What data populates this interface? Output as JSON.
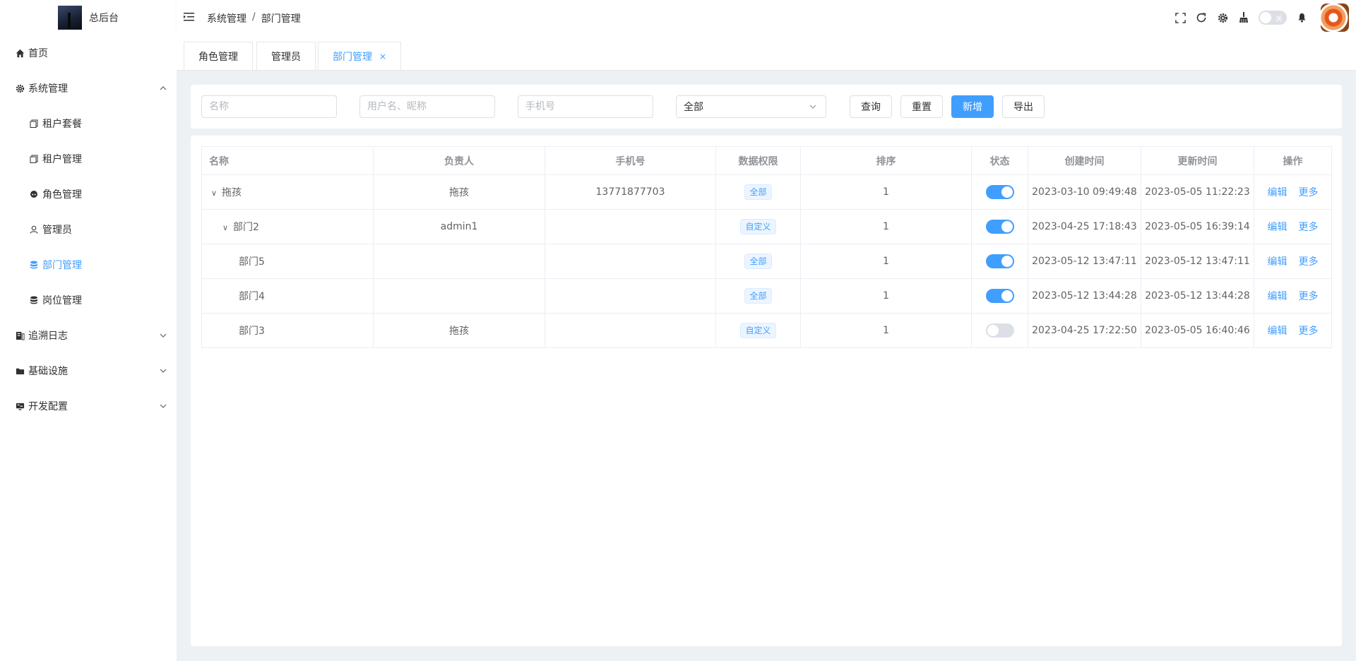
{
  "sidebar": {
    "logo_text": "总后台",
    "menu": [
      {
        "label": "首页",
        "icon": "home-icon"
      },
      {
        "label": "系统管理",
        "icon": "gear-icon",
        "expanded": true,
        "children": [
          {
            "label": "租户套餐",
            "icon": "copy-icon"
          },
          {
            "label": "租户管理",
            "icon": "copy-icon"
          },
          {
            "label": "角色管理",
            "icon": "role-icon"
          },
          {
            "label": "管理员",
            "icon": "user-icon"
          },
          {
            "label": "部门管理",
            "icon": "database-icon",
            "active": true
          },
          {
            "label": "岗位管理",
            "icon": "database-icon"
          }
        ]
      },
      {
        "label": "追溯日志",
        "icon": "log-icon"
      },
      {
        "label": "基础设施",
        "icon": "folder-icon"
      },
      {
        "label": "开发配置",
        "icon": "monitor-icon"
      }
    ]
  },
  "header": {
    "breadcrumb": [
      "系统管理",
      "部门管理"
    ],
    "breadcrumb_sep": "/",
    "toggle_label": "关"
  },
  "tabs": [
    {
      "label": "角色管理"
    },
    {
      "label": "管理员"
    },
    {
      "label": "部门管理",
      "active": true,
      "close": "×"
    }
  ],
  "search": {
    "name_placeholder": "名称",
    "user_placeholder": "用户名、昵称",
    "phone_placeholder": "手机号",
    "status_value": "全部",
    "buttons": {
      "query": "查询",
      "reset": "重置",
      "add": "新增",
      "export": "导出"
    }
  },
  "table": {
    "columns": [
      "名称",
      "负责人",
      "手机号",
      "数据权限",
      "排序",
      "状态",
      "创建时间",
      "更新时间",
      "操作"
    ],
    "rows": [
      {
        "name": "拖孩",
        "level": 0,
        "expand": "∨",
        "owner": "拖孩",
        "phone": "13771877703",
        "scope": "全部",
        "sort": "1",
        "enabled": true,
        "created": "2023-03-10 09:49:48",
        "updated": "2023-05-05 11:22:23"
      },
      {
        "name": "部门2",
        "level": 1,
        "expand": "∨",
        "owner": "admin1",
        "phone": "",
        "scope": "自定义",
        "sort": "1",
        "enabled": true,
        "created": "2023-04-25 17:18:43",
        "updated": "2023-05-05 16:39:14"
      },
      {
        "name": "部门5",
        "level": 2,
        "expand": "",
        "owner": "",
        "phone": "",
        "scope": "全部",
        "sort": "1",
        "enabled": true,
        "created": "2023-05-12 13:47:11",
        "updated": "2023-05-12 13:47:11"
      },
      {
        "name": "部门4",
        "level": 2,
        "expand": "",
        "owner": "",
        "phone": "",
        "scope": "全部",
        "sort": "1",
        "enabled": true,
        "created": "2023-05-12 13:44:28",
        "updated": "2023-05-12 13:44:28"
      },
      {
        "name": "部门3",
        "level": 2,
        "expand": "",
        "owner": "拖孩",
        "phone": "",
        "scope": "自定义",
        "sort": "1",
        "enabled": false,
        "created": "2023-04-25 17:22:50",
        "updated": "2023-05-05 16:40:46"
      }
    ],
    "actions": {
      "edit": "编辑",
      "more": "更多"
    }
  },
  "colors": {
    "accent": "#409eff",
    "switch_off": "#dcdfe6",
    "bg": "#eef1f4"
  }
}
